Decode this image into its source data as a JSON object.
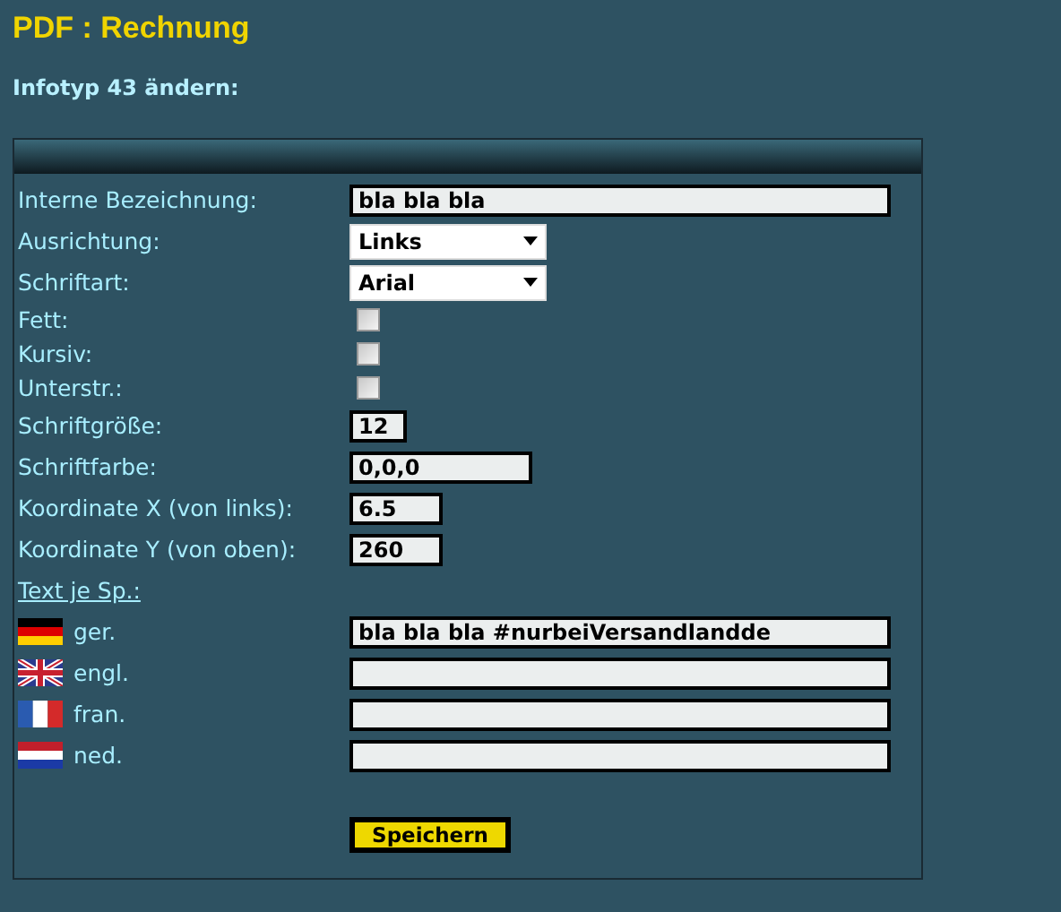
{
  "title": "PDF : Rechnung",
  "subtitle": "Infotyp 43 ändern:",
  "fields": [
    {
      "kind": "text",
      "label": "Interne Bezeichnung:",
      "value": "bla bla bla"
    },
    {
      "kind": "select",
      "label": "Ausrichtung:",
      "value": "Links"
    },
    {
      "kind": "select",
      "label": "Schriftart:",
      "value": "Arial"
    },
    {
      "kind": "checkbox",
      "label": "Fett:",
      "checked": false
    },
    {
      "kind": "checkbox",
      "label": "Kursiv:",
      "checked": false
    },
    {
      "kind": "checkbox",
      "label": "Unterstr.:",
      "checked": false
    },
    {
      "kind": "text",
      "label": "Schriftgröße:",
      "value": "12"
    },
    {
      "kind": "text",
      "label": "Schriftfarbe:",
      "value": "0,0,0"
    },
    {
      "kind": "text",
      "label": "Koordinate X (von links):",
      "value": "6.5"
    },
    {
      "kind": "text",
      "label": "Koordinate Y (von oben):",
      "value": "260"
    }
  ],
  "texts_link": "Text je Sp.:",
  "languages": [
    {
      "kind": "de",
      "label": "ger.",
      "value": "bla bla bla #nurbeiVersandlandde"
    },
    {
      "kind": "gb",
      "label": "engl."
    },
    {
      "kind": "fr",
      "label": "fran."
    },
    {
      "kind": "nl",
      "label": "ned."
    }
  ],
  "save_button": "Speichern"
}
